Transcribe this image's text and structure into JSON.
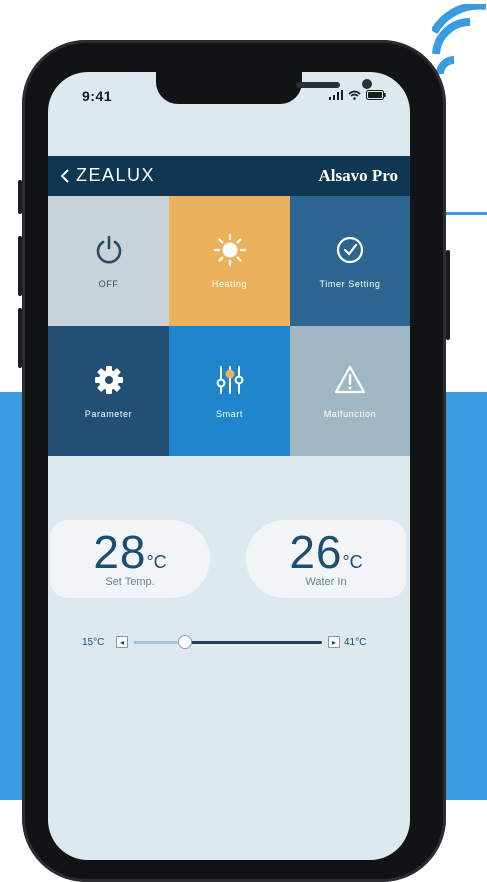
{
  "status": {
    "time": "9:41"
  },
  "header": {
    "back_label": "ZEALUX",
    "title": "Alsavo Pro"
  },
  "tiles": [
    {
      "label": "OFF",
      "icon": "power-icon",
      "bg": "#c7d2d9",
      "fg": "#2b4a5f",
      "label_color": "#3a4f5e"
    },
    {
      "label": "Heating",
      "icon": "sun-icon",
      "bg": "#ecb25b",
      "fg": "#ffffff",
      "label_color": "#ffffff"
    },
    {
      "label": "Timer Setting",
      "icon": "clock-icon",
      "bg": "#2d6591",
      "fg": "#ffffff",
      "label_color": "#ffffff"
    },
    {
      "label": "Parameter",
      "icon": "gear-icon",
      "bg": "#224f73",
      "fg": "#ffffff",
      "label_color": "#ffffff"
    },
    {
      "label": "Smart",
      "icon": "sliders-icon",
      "bg": "#1f86cc",
      "fg": "#ffffff",
      "label_color": "#ffffff"
    },
    {
      "label": "Malfunction",
      "icon": "warning-icon",
      "bg": "#9fb7c2",
      "fg": "#ffffff",
      "label_color": "#ffffff"
    }
  ],
  "set_temp": {
    "value": "28",
    "unit": "°C",
    "label": "Set Temp."
  },
  "water_in": {
    "value": "26",
    "unit": "°C",
    "label": "Water In"
  },
  "slider": {
    "min_label": "15°C",
    "max_label": "41°C",
    "value": 22,
    "min": 15,
    "max": 41
  },
  "colors": {
    "header_bg": "#0f3753",
    "accent_blue": "#3a9be0",
    "screen_bg": "#dde8ef"
  }
}
